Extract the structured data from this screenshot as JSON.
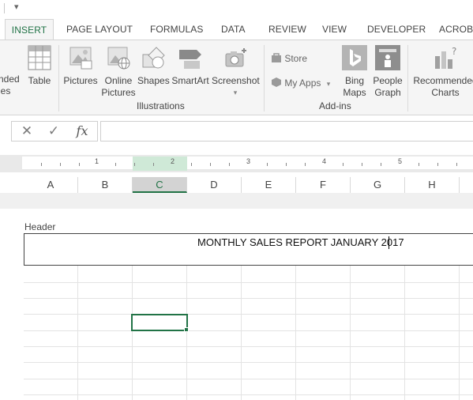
{
  "ribbon_tabs": {
    "insert": "INSERT",
    "page_layout": "PAGE LAYOUT",
    "formulas": "FORMULAS",
    "data": "DATA",
    "review": "REVIEW",
    "view": "VIEW",
    "developer": "DEVELOPER",
    "acrobat": "ACROBA"
  },
  "ribbon": {
    "tables_partial_line1": "nded",
    "tables_partial_line2": "les",
    "table": "Table",
    "pictures": "Pictures",
    "online_pictures_line1": "Online",
    "online_pictures_line2": "Pictures",
    "shapes": "Shapes",
    "smartart": "SmartArt",
    "screenshot": "Screenshot",
    "illustrations_group": "Illustrations",
    "store": "Store",
    "my_apps": "My Apps",
    "bing_maps_line1": "Bing",
    "bing_maps_line2": "Maps",
    "people_graph_line1": "People",
    "people_graph_line2": "Graph",
    "addins_group": "Add-ins",
    "recommended_charts_line1": "Recommended",
    "recommended_charts_line2": "Charts"
  },
  "formula_bar": {
    "cancel_glyph": "✕",
    "enter_glyph": "✓",
    "fx_label": "fx",
    "value": ""
  },
  "ruler_numbers": [
    "1",
    "2",
    "3",
    "4",
    "5"
  ],
  "columns": [
    "A",
    "B",
    "C",
    "D",
    "E",
    "F",
    "G",
    "H"
  ],
  "selected_column": "C",
  "page": {
    "header_label": "Header",
    "header_text": "MONTHLY SALES REPORT JANUARY 2017"
  },
  "colors": {
    "accent_green": "#217346",
    "ruler_highlight": "#cfe9d7",
    "ribbon_bg": "#f5f5f5"
  },
  "icons": {
    "qat_dropdown": "dropdown-arrow-icon",
    "table": "table-icon",
    "pictures": "pictures-icon",
    "online_pictures": "online-pictures-icon",
    "shapes": "shapes-icon",
    "smartart": "smartart-icon",
    "screenshot": "screenshot-icon",
    "store": "store-icon",
    "my_apps": "my-apps-icon",
    "bing_maps": "bing-maps-icon",
    "people_graph": "people-graph-icon",
    "recommended_charts": "recommended-charts-icon"
  }
}
